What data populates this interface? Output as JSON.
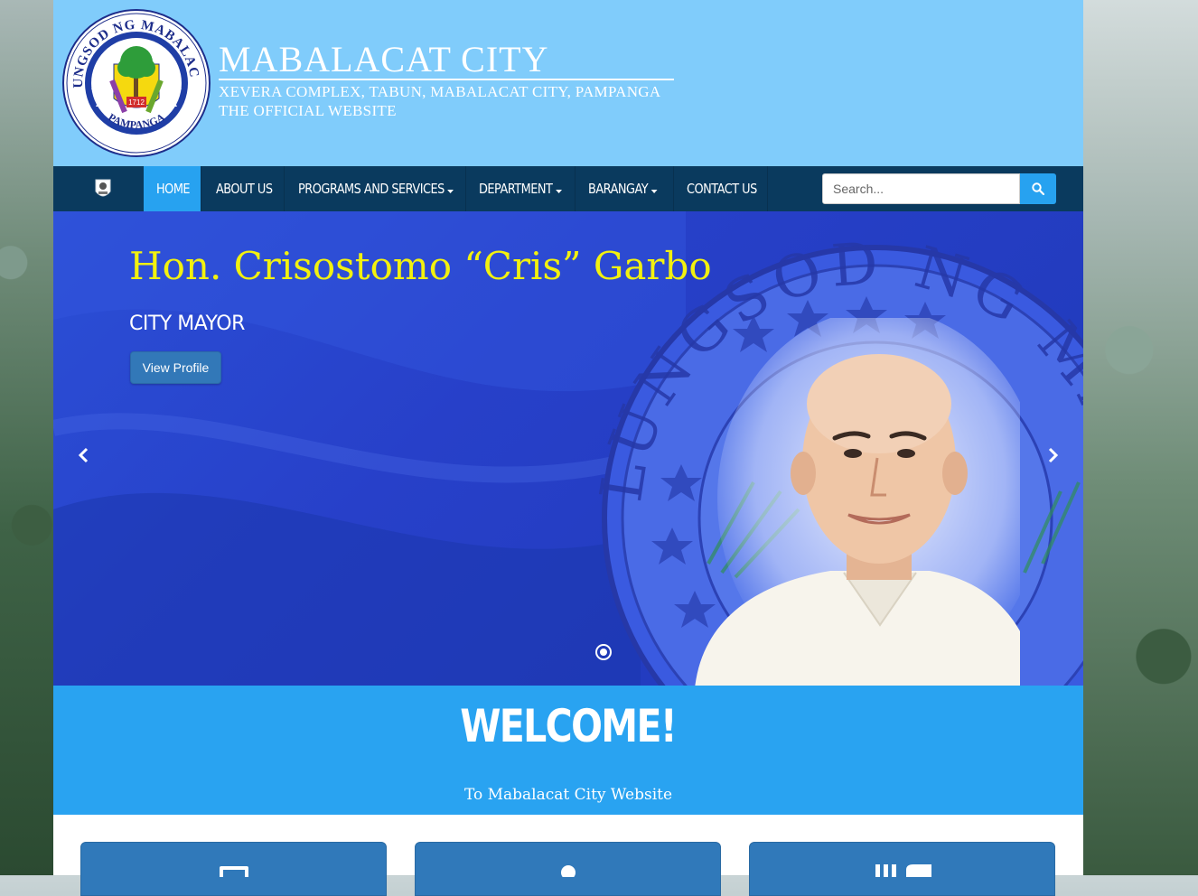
{
  "header": {
    "title": "MABALACAT CITY",
    "address": "XEVERA COMPLEX, TABUN, MABALACAT CITY, PAMPANGA",
    "tagline": "THE OFFICIAL WEBSITE",
    "seal": {
      "top_text": "LUNGSOD NG MABALACAT",
      "bottom_text": "PAMPANGA",
      "year": "1712"
    }
  },
  "nav": {
    "items": [
      {
        "label": "HOME",
        "active": true
      },
      {
        "label": "ABOUT US"
      },
      {
        "label": "PROGRAMS AND SERVICES",
        "dropdown": true
      },
      {
        "label": "DEPARTMENT",
        "dropdown": true
      },
      {
        "label": "BARANGAY",
        "dropdown": true
      },
      {
        "label": "CONTACT US"
      }
    ],
    "search": {
      "placeholder": "Search..."
    }
  },
  "hero": {
    "name": "Hon. Crisostomo “Cris” Garbo",
    "role": "CITY MAYOR",
    "button": "View Profile",
    "seal_text": "LUNGSOD NG MABAL"
  },
  "welcome": {
    "title": "WELCOME!",
    "subtitle": "To Mabalacat City Website"
  },
  "colors": {
    "header_bg": "#80ccfb",
    "nav_bg": "#0a3a5e",
    "nav_active": "#27a2f0",
    "hero_bg": "#2740c9",
    "hero_name": "#f2f10f",
    "welcome_bg": "#29a3f1",
    "card_bg": "#3079ba"
  }
}
